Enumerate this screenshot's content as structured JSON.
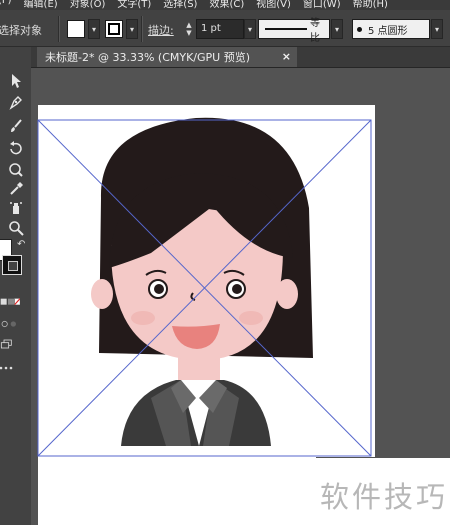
{
  "menubar": {
    "items": [
      "(F)",
      "编辑(E)",
      "对象(O)",
      "文字(T)",
      "选择(S)",
      "效果(C)",
      "视图(V)",
      "窗口(W)",
      "帮助(H)"
    ]
  },
  "controlbar": {
    "selection_label": "选择对象",
    "stroke_label": "描边:",
    "stroke_weight": "1 pt",
    "profile_label": "等比",
    "brush_label": "5 点圆形"
  },
  "document": {
    "tab_title": "未标题-2* @ 33.33% (CMYK/GPU 预览)",
    "close_glyph": "×"
  },
  "watermark": {
    "text": "软件技巧"
  },
  "colors": {
    "ui_bg": "#535353",
    "panel": "#424242",
    "hair": "#231a1a",
    "skin": "#f4c9c7",
    "jacket": "#3a3a3a",
    "guide": "#5566cc"
  },
  "icons": [
    "selection-tool-icon",
    "pen-tool-icon",
    "brush-tool-icon",
    "rotate-tool-icon",
    "warp-tool-icon",
    "eyedropper-tool-icon",
    "symbol-sprayer-icon",
    "hand-tool-icon",
    "zoom-tool-icon",
    "swap-fill-stroke-icon",
    "default-colors-icon",
    "none-color-icon",
    "draw-mode-icon",
    "screen-mode-icon",
    "more-tools-icon"
  ]
}
